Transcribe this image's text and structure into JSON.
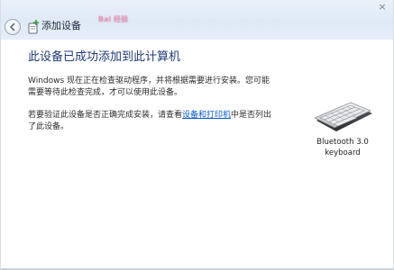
{
  "window": {
    "title": "添加设备",
    "close_glyph": "×"
  },
  "watermark": {
    "text": "Bai 经验"
  },
  "main": {
    "heading": "此设备已成功添加到此计算机",
    "paragraph1": "Windows 现在正在检查驱动程序，并将根据需要进行安装。您可能需要等待此检查完成，才可以使用此设备。",
    "paragraph2_before": "若要验证此设备是否正确完成安装，请查看",
    "paragraph2_link": "设备和打印机",
    "paragraph2_after": "中是否列出了此设备。"
  },
  "device": {
    "icon": "keyboard-icon",
    "label_line1": "Bluetooth 3.0",
    "label_line2": "keyboard"
  },
  "colors": {
    "heading": "#1f3a78",
    "link": "#0a59c9",
    "titlebar": "#dfe9f5"
  }
}
